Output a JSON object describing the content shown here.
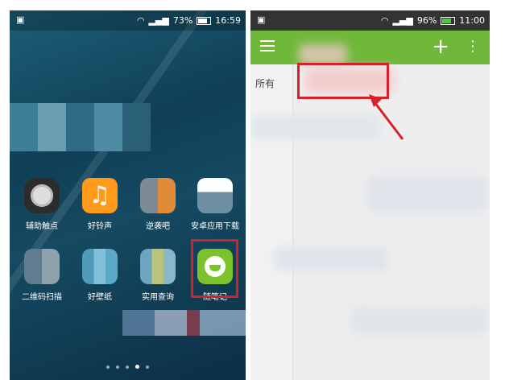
{
  "left_phone": {
    "status": {
      "battery": "73%",
      "time": "16:59"
    },
    "apps": [
      {
        "label": "辅助触点"
      },
      {
        "label": "好铃声"
      },
      {
        "label": "逆袭吧"
      },
      {
        "label": "安卓应用下载"
      },
      {
        "label": "二维码扫描"
      },
      {
        "label": "好壁纸"
      },
      {
        "label": "实用查询"
      },
      {
        "label": "随笔记"
      }
    ],
    "page_indicator": {
      "pages": 5,
      "current": 4
    }
  },
  "right_phone": {
    "status": {
      "battery": "96%",
      "time": "11:00"
    },
    "sidebar": {
      "label": "所有"
    }
  },
  "colors": {
    "highlight": "#d8202a",
    "appbar": "#6fb83a"
  }
}
